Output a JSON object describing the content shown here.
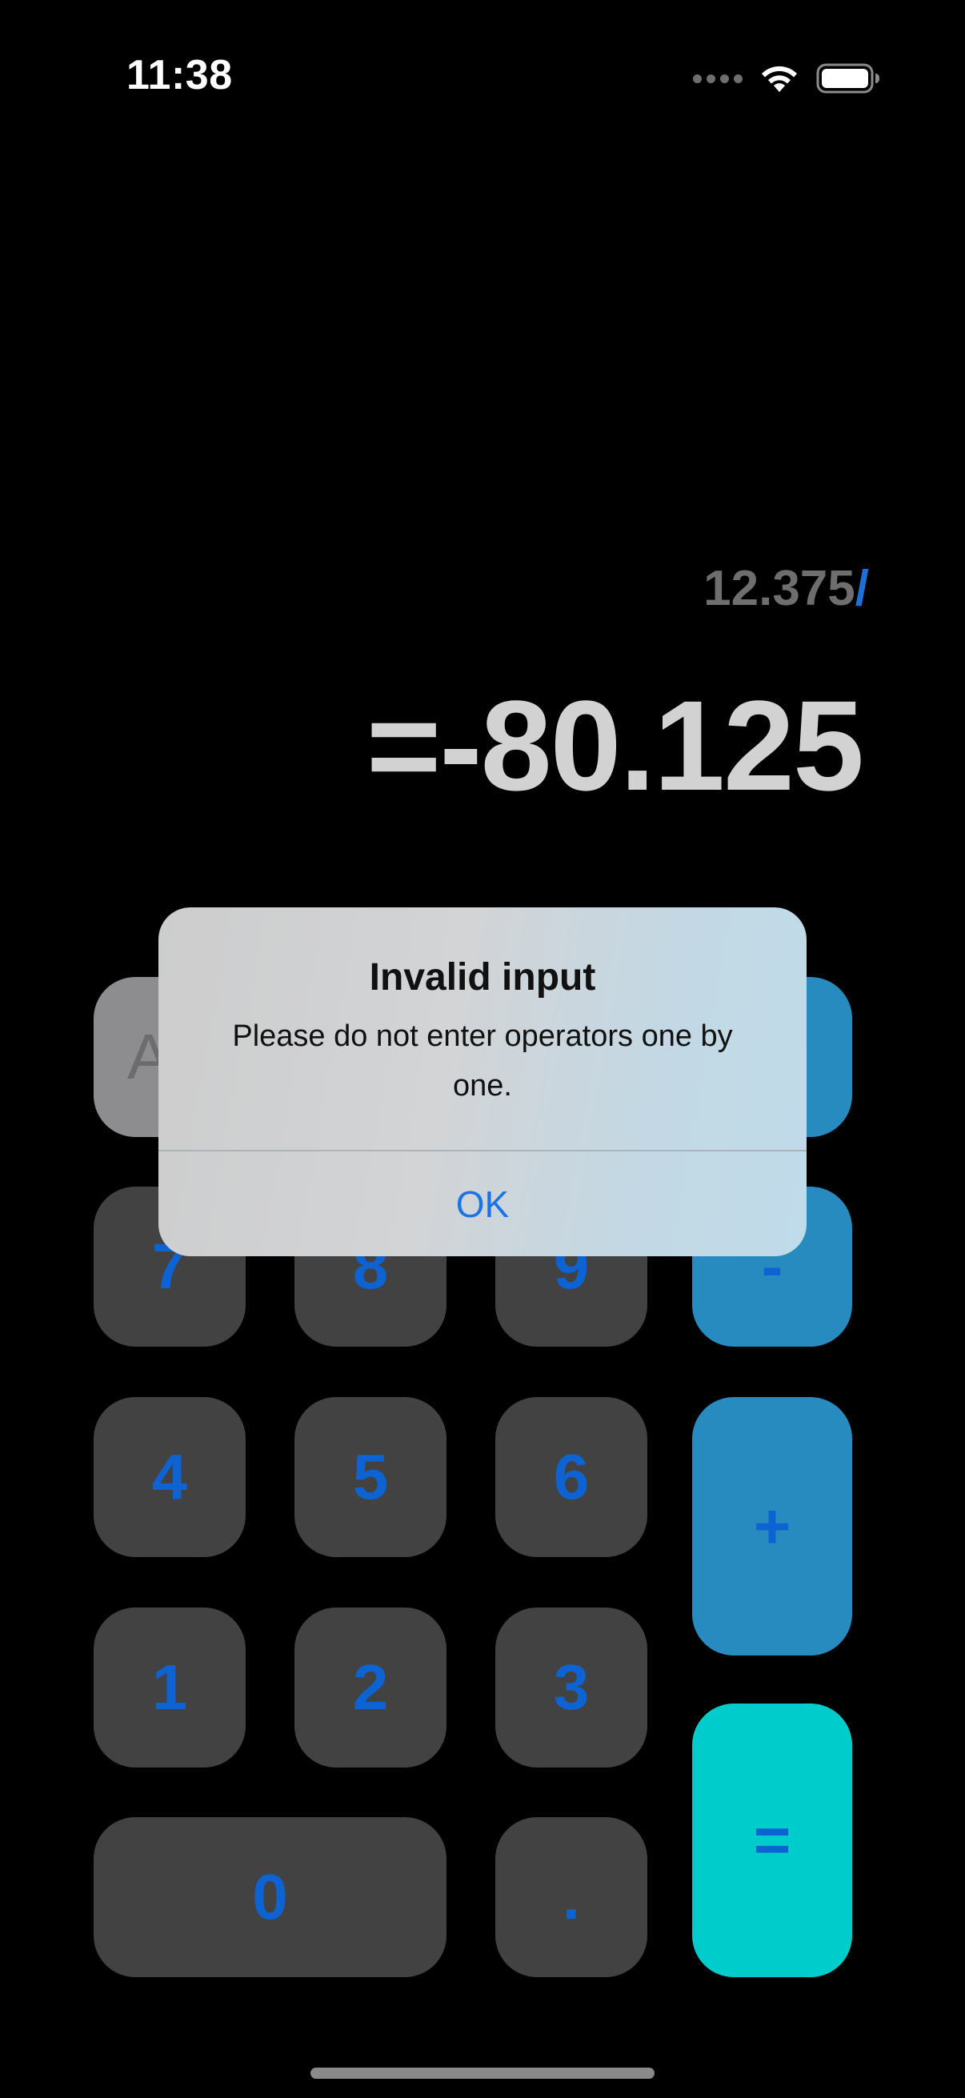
{
  "status_bar": {
    "time": "11:38",
    "icons": [
      "cellular-dots-icon",
      "wifi-icon",
      "battery-icon"
    ]
  },
  "display": {
    "expression_number": "12.375",
    "expression_operator": "/",
    "result": "=-80.125"
  },
  "keypad": {
    "ac": "AC",
    "seven": "7",
    "eight": "8",
    "nine": "9",
    "minus": "-",
    "four": "4",
    "five": "5",
    "six": "6",
    "plus": "+",
    "one": "1",
    "two": "2",
    "three": "3",
    "zero": "0",
    "decimal": ".",
    "equals": "="
  },
  "alert": {
    "title": "Invalid input",
    "message": "Please do not enter operators one by one.",
    "ok_label": "OK"
  },
  "colors": {
    "background": "#000000",
    "number_key": "#424242",
    "operator_key": "#288bbf",
    "equals_key": "#00cccc",
    "key_text": "#0d63d1",
    "alert_button": "#1a73e8"
  }
}
